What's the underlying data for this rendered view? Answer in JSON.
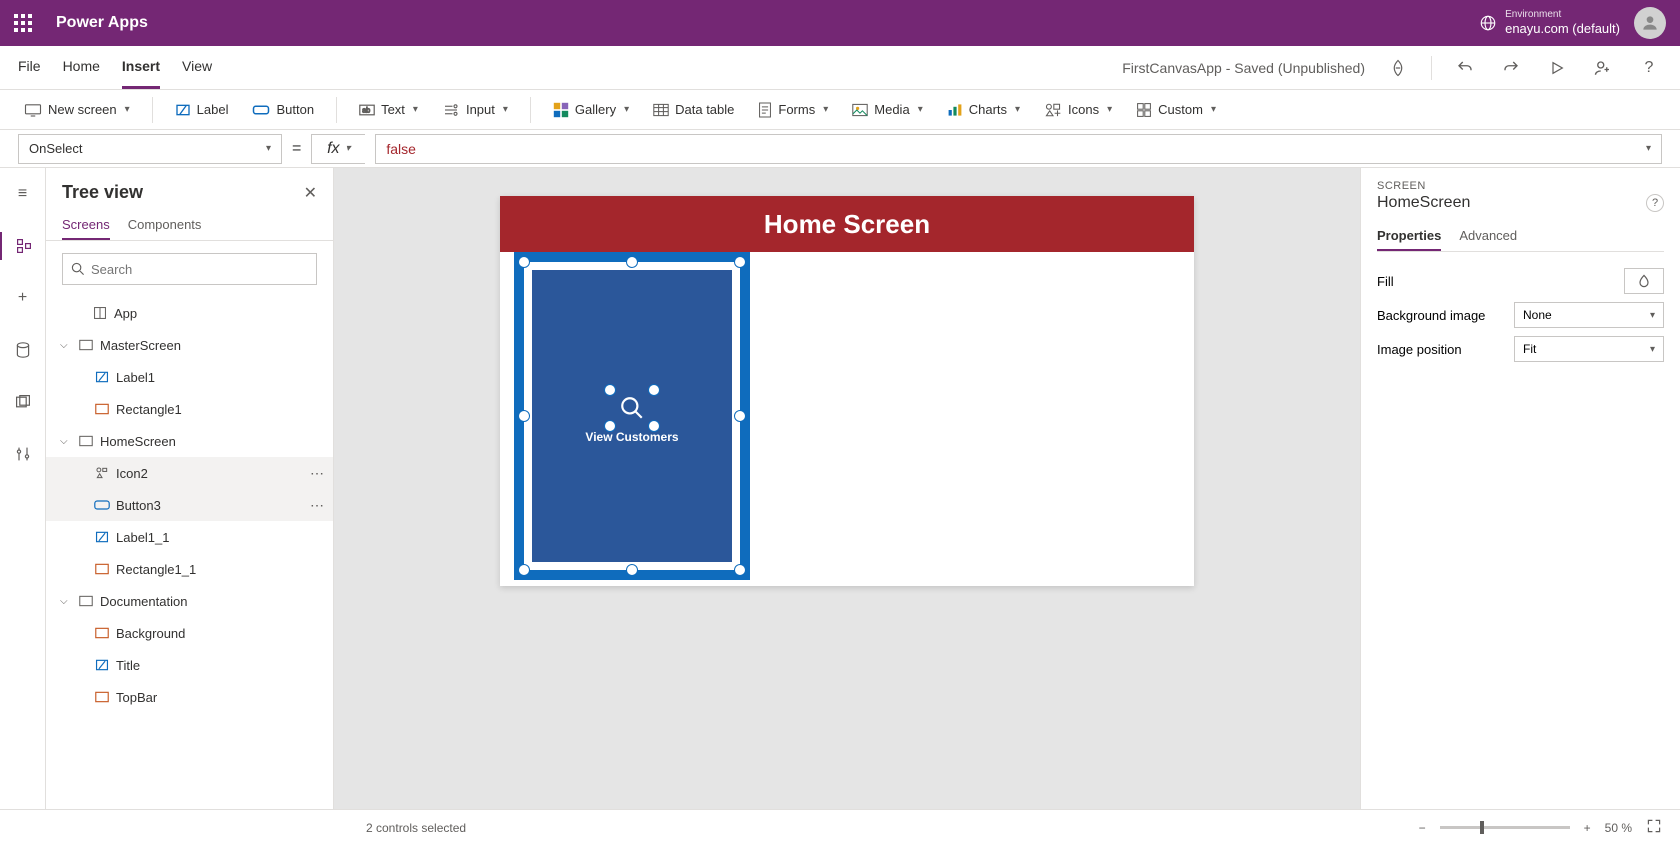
{
  "topbar": {
    "app_name": "Power Apps",
    "env_label": "Environment",
    "env_name": "enayu.com (default)"
  },
  "menubar": {
    "tabs": [
      "File",
      "Home",
      "Insert",
      "View"
    ],
    "active": "Insert",
    "doc_title": "FirstCanvasApp - Saved (Unpublished)"
  },
  "ribbon": {
    "new_screen": "New screen",
    "label": "Label",
    "button": "Button",
    "text": "Text",
    "input": "Input",
    "gallery": "Gallery",
    "data_table": "Data table",
    "forms": "Forms",
    "media": "Media",
    "charts": "Charts",
    "icons": "Icons",
    "custom": "Custom"
  },
  "formula": {
    "property": "OnSelect",
    "value": "false"
  },
  "tree": {
    "title": "Tree view",
    "tab_screens": "Screens",
    "tab_components": "Components",
    "search_placeholder": "Search",
    "nodes": {
      "app": "App",
      "master": "MasterScreen",
      "label1": "Label1",
      "rect1": "Rectangle1",
      "home": "HomeScreen",
      "icon2": "Icon2",
      "button3": "Button3",
      "label11": "Label1_1",
      "rect11": "Rectangle1_1",
      "doc": "Documentation",
      "bg": "Background",
      "title": "Title",
      "topbar": "TopBar"
    }
  },
  "canvas": {
    "header": "Home Screen",
    "card_label": "View Customers"
  },
  "props": {
    "category": "SCREEN",
    "object_name": "HomeScreen",
    "tab_props": "Properties",
    "tab_adv": "Advanced",
    "fill_label": "Fill",
    "bgimg_label": "Background image",
    "bgimg_value": "None",
    "imgpos_label": "Image position",
    "imgpos_value": "Fit"
  },
  "status": {
    "selection": "2 controls selected",
    "zoom": "50  %"
  }
}
